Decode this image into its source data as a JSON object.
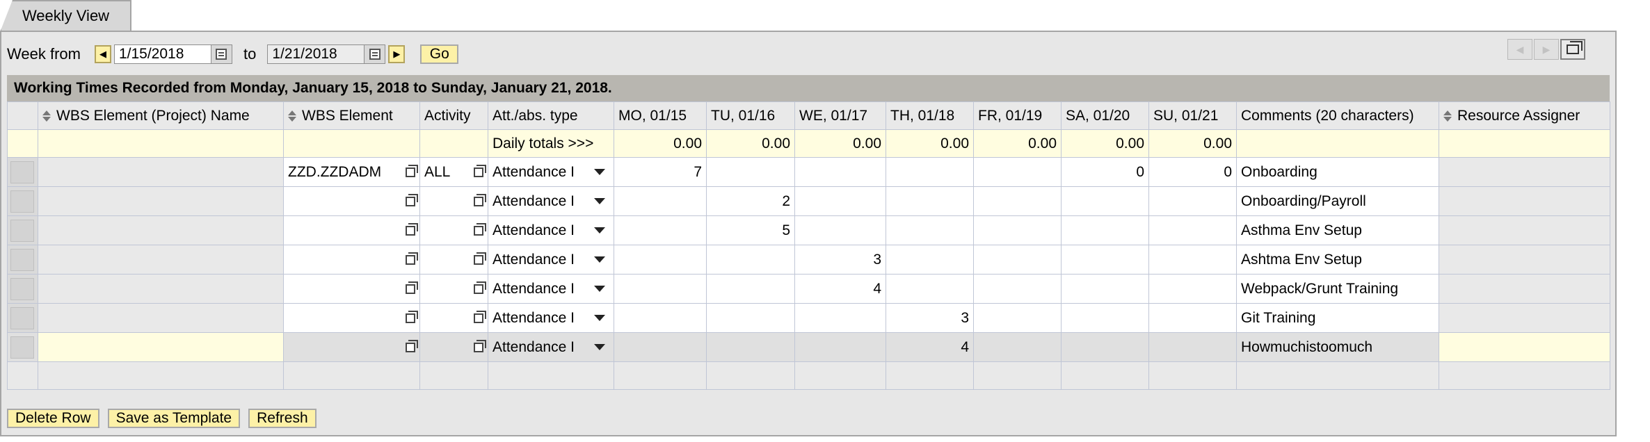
{
  "tab": {
    "label": "Weekly View"
  },
  "week": {
    "from_label": "Week from",
    "from_value": "1/15/2018",
    "to_label": "to",
    "to_value": "1/21/2018",
    "go_label": "Go"
  },
  "table": {
    "caption": "Working Times Recorded from Monday, January 15, 2018 to Sunday, January 21, 2018.",
    "headers": {
      "wbs_name": "WBS Element (Project) Name",
      "wbs": "WBS Element",
      "activity": "Activity",
      "att": "Att./abs. type",
      "mo": "MO, 01/15",
      "tu": "TU, 01/16",
      "we": "WE, 01/17",
      "th": "TH, 01/18",
      "fr": "FR, 01/19",
      "sa": "SA, 01/20",
      "su": "SU, 01/21",
      "comments": "Comments (20 characters)",
      "resource": "Resource Assigner"
    },
    "totals": {
      "label": "Daily totals >>>",
      "mo": "0.00",
      "tu": "0.00",
      "we": "0.00",
      "th": "0.00",
      "fr": "0.00",
      "sa": "0.00",
      "su": "0.00"
    },
    "rows": [
      {
        "wbs": "ZZD.ZZDADM",
        "activity": "ALL",
        "att": "Attendance I",
        "mo": "7",
        "tu": "",
        "we": "",
        "th": "",
        "fr": "",
        "sa": "0",
        "su": "0",
        "comment": "Onboarding"
      },
      {
        "wbs": "",
        "activity": "",
        "att": "Attendance I",
        "mo": "",
        "tu": "2",
        "we": "",
        "th": "",
        "fr": "",
        "sa": "",
        "su": "",
        "comment": "Onboarding/Payroll"
      },
      {
        "wbs": "",
        "activity": "",
        "att": "Attendance I",
        "mo": "",
        "tu": "5",
        "we": "",
        "th": "",
        "fr": "",
        "sa": "",
        "su": "",
        "comment": "Asthma Env Setup"
      },
      {
        "wbs": "",
        "activity": "",
        "att": "Attendance I",
        "mo": "",
        "tu": "",
        "we": "3",
        "th": "",
        "fr": "",
        "sa": "",
        "su": "",
        "comment": "Ashtma Env Setup"
      },
      {
        "wbs": "",
        "activity": "",
        "att": "Attendance I",
        "mo": "",
        "tu": "",
        "we": "4",
        "th": "",
        "fr": "",
        "sa": "",
        "su": "",
        "comment": "Webpack/Grunt Training"
      },
      {
        "wbs": "",
        "activity": "",
        "att": "Attendance I",
        "mo": "",
        "tu": "",
        "we": "",
        "th": "3",
        "fr": "",
        "sa": "",
        "su": "",
        "comment": "Git Training"
      },
      {
        "wbs": "",
        "activity": "",
        "att": "Attendance I",
        "mo": "",
        "tu": "",
        "we": "",
        "th": "4",
        "fr": "",
        "sa": "",
        "su": "",
        "comment": "Howmuchistoomuch"
      }
    ]
  },
  "buttons": {
    "delete_row": "Delete Row",
    "save_template": "Save as Template",
    "refresh": "Refresh"
  },
  "icons": {
    "prev": "arrow-left-icon",
    "next": "arrow-right-icon",
    "calendar": "calendar-icon",
    "f4": "value-help-icon",
    "dropdown": "dropdown-arrow-icon"
  }
}
